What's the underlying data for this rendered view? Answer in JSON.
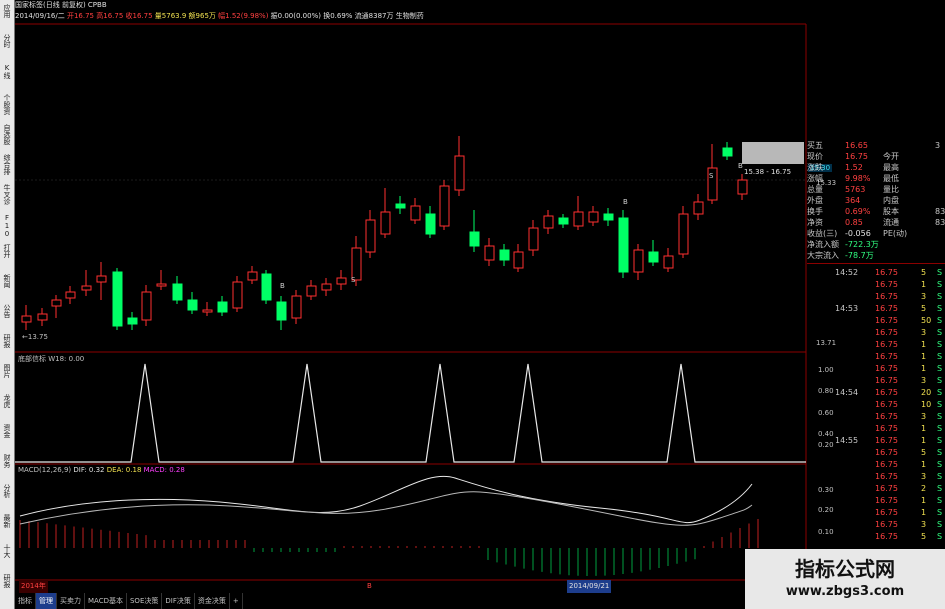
{
  "window": {
    "title": "国家标签(日线 前复权) CPBB",
    "quote_line": {
      "date": "2014/09/16/二",
      "open": "开16.75",
      "high": "高16.75",
      "low": "收16.75",
      "vol": "量5763.9",
      "amount": "额965万",
      "change": "幅1.52(9.98%)",
      "amp": "振0.00(0.00%)",
      "turnover": "换0.69%",
      "float": "流通8387万",
      "label": "生物制药"
    }
  },
  "sidebar": {
    "tabs": [
      "应用",
      "分时",
      "K线",
      "个股资料",
      "自选股",
      "综合排名",
      "牛叉诊断",
      "F10",
      "打开",
      "新闻",
      "公告",
      "研报",
      "图片",
      "龙虎",
      "资金",
      "财务",
      "分析",
      "最新",
      "十大",
      "研报"
    ]
  },
  "main_chart": {
    "price_labels": {
      "low_mark": "←13.75",
      "high_box": "15.38 - 16.75",
      "right_top": "15.30",
      "right_mid": "15.33",
      "right_low": "13.71"
    },
    "signal_marks": [
      "B",
      "S",
      "B",
      "S",
      "B"
    ]
  },
  "indicator1": {
    "title": "底部信标 W18: 0.00",
    "axis": [
      "1.00",
      "0.80",
      "0.60",
      "0.40",
      "0.20"
    ]
  },
  "indicator2": {
    "title_macd": "MACD(12,26,9)",
    "dif": "DIF: 0.32",
    "dea": "DEA: 0.18",
    "macd": "MACD: 0.28",
    "axis": [
      "0.30",
      "0.20",
      "0.10"
    ]
  },
  "date_bar": {
    "left": "2014年",
    "mid": "2014/09/21",
    "marker": "B"
  },
  "bottom_tabs": {
    "labels": [
      "指标",
      "管理",
      "买卖力",
      "MACD基本",
      "SOE决策",
      "DIF决策",
      "资金决策",
      "+"
    ],
    "active_index": 1
  },
  "quote_panel": {
    "rows": [
      {
        "k": "买五",
        "v": "16.65",
        "v2": "",
        "n": "3"
      },
      {
        "k": "现价",
        "v": "16.75",
        "v2": "今开",
        "n": ""
      },
      {
        "k": "涨跌",
        "v": "1.52",
        "v2": "最高",
        "n": ""
      },
      {
        "k": "涨幅",
        "v": "9.98%",
        "v2": "最低",
        "n": ""
      },
      {
        "k": "总量",
        "v": "5763",
        "v2": "量比",
        "n": ""
      },
      {
        "k": "外盘",
        "v": "364",
        "v2": "内盘",
        "n": ""
      },
      {
        "k": "换手",
        "v": "0.69%",
        "v2": "股本",
        "n": "83"
      },
      {
        "k": "净资",
        "v": "0.85",
        "v2": "流通",
        "n": "83"
      },
      {
        "k": "收益(三)",
        "v": "-0.056",
        "v2": "PE(动)",
        "n": ""
      },
      {
        "k": "净流入额",
        "v": "-722.3万",
        "v2": "",
        "n": ""
      },
      {
        "k": "大宗流入",
        "v": "-78.7万",
        "v2": "",
        "n": ""
      }
    ],
    "ticks": [
      {
        "t": "14:52",
        "p": "16.75",
        "v": "5",
        "s": "S"
      },
      {
        "t": "",
        "p": "16.75",
        "v": "1",
        "s": "S"
      },
      {
        "t": "",
        "p": "16.75",
        "v": "3",
        "s": "S"
      },
      {
        "t": "14:53",
        "p": "16.75",
        "v": "5",
        "s": "S"
      },
      {
        "t": "",
        "p": "16.75",
        "v": "50",
        "s": "S"
      },
      {
        "t": "",
        "p": "16.75",
        "v": "3",
        "s": "S"
      },
      {
        "t": "",
        "p": "16.75",
        "v": "1",
        "s": "S"
      },
      {
        "t": "",
        "p": "16.75",
        "v": "1",
        "s": "S"
      },
      {
        "t": "",
        "p": "16.75",
        "v": "1",
        "s": "S"
      },
      {
        "t": "",
        "p": "16.75",
        "v": "3",
        "s": "S"
      },
      {
        "t": "14:54",
        "p": "16.75",
        "v": "20",
        "s": "S"
      },
      {
        "t": "",
        "p": "16.75",
        "v": "10",
        "s": "S"
      },
      {
        "t": "",
        "p": "16.75",
        "v": "3",
        "s": "S"
      },
      {
        "t": "",
        "p": "16.75",
        "v": "1",
        "s": "S"
      },
      {
        "t": "14:55",
        "p": "16.75",
        "v": "1",
        "s": "S"
      },
      {
        "t": "",
        "p": "16.75",
        "v": "5",
        "s": "S"
      },
      {
        "t": "",
        "p": "16.75",
        "v": "1",
        "s": "S"
      },
      {
        "t": "",
        "p": "16.75",
        "v": "3",
        "s": "S"
      },
      {
        "t": "",
        "p": "16.75",
        "v": "2",
        "s": "S"
      },
      {
        "t": "",
        "p": "16.75",
        "v": "1",
        "s": "S"
      },
      {
        "t": "",
        "p": "16.75",
        "v": "1",
        "s": "S"
      },
      {
        "t": "",
        "p": "16.75",
        "v": "3",
        "s": "S"
      },
      {
        "t": "",
        "p": "16.75",
        "v": "5",
        "s": "S"
      }
    ]
  },
  "watermark": {
    "line1": "指标公式网",
    "line2": "www.zbgs3.com"
  },
  "colors": {
    "up": "#ff3030",
    "down": "#00ff66",
    "grid": "#8b0000",
    "bg": "#000000"
  }
}
